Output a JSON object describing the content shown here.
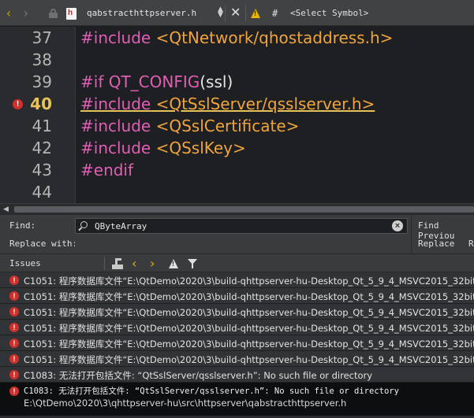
{
  "tabbar": {
    "back_glyph": "‹",
    "forward_glyph": "›",
    "filename": "qabstracthttpserver.h",
    "file_icon_letter": "h",
    "close_glyph": "✕",
    "hash": "#",
    "symbol_selector": "<Select Symbol>"
  },
  "editor": {
    "lines": [
      {
        "number": "37",
        "code": "#include <QtNetwork/qhostaddress.h>"
      },
      {
        "number": "38",
        "code": ""
      },
      {
        "number": "39",
        "code": "#if QT_CONFIG(ssl)"
      },
      {
        "number": "40",
        "code": "#include <QtSslServer/qsslserver.h>"
      },
      {
        "number": "41",
        "code": "#include <QSslCertificate>"
      },
      {
        "number": "42",
        "code": "#include <QSslKey>"
      },
      {
        "number": "43",
        "code": "#endif"
      },
      {
        "number": "44",
        "code": ""
      }
    ],
    "tokens": {
      "l37_kw": "#include",
      "l37_str": " <QtNetwork/qhostaddress.h>",
      "l39_kw": "#if",
      "l39_macro": " QT_CONFIG",
      "l39_rest": "(ssl)",
      "l40_kw": "#include",
      "l40_str": "<QtSslServer/qsslserver.h>",
      "l41_kw": "#include",
      "l41_str": " <QSslCertificate>",
      "l42_kw": "#include",
      "l42_str": " <QSslKey>",
      "l43_kw": "#endif"
    }
  },
  "findbar": {
    "find_label": "Find:",
    "find_value": "QByteArray",
    "replace_label": "Replace with:",
    "find_previous": "Find Previou",
    "replace_button": "Replace",
    "replace_trunc": "R"
  },
  "issues": {
    "title": "Issues",
    "prev_glyph": "‹",
    "next_glyph": "›",
    "items": [
      {
        "text": "C1051: 程序数据库文件“E:\\QtDemo\\2020\\3\\build-qhttpserver-hu-Desktop_Qt_5_9_4_MSVC2015_32bit"
      },
      {
        "text": "C1051: 程序数据库文件“E:\\QtDemo\\2020\\3\\build-qhttpserver-hu-Desktop_Qt_5_9_4_MSVC2015_32bit"
      },
      {
        "text": "C1051: 程序数据库文件“E:\\QtDemo\\2020\\3\\build-qhttpserver-hu-Desktop_Qt_5_9_4_MSVC2015_32bit"
      },
      {
        "text": "C1051: 程序数据库文件“E:\\QtDemo\\2020\\3\\build-qhttpserver-hu-Desktop_Qt_5_9_4_MSVC2015_32bit"
      },
      {
        "text": "C1051: 程序数据库文件“E:\\QtDemo\\2020\\3\\build-qhttpserver-hu-Desktop_Qt_5_9_4_MSVC2015_32bit"
      },
      {
        "text": "C1051: 程序数据库文件“E:\\QtDemo\\2020\\3\\build-qhttpserver-hu-Desktop_Qt_5_9_4_MSVC2015_32bit"
      },
      {
        "text": "C1083: 无法打开包括文件: “QtSslServer/qsslserver.h”: No such file or directory"
      }
    ],
    "selected": {
      "text": "C1083: 无法打开包括文件: “QtSslServer/qsslserver.h”: No such file or directory",
      "path": "E:\\QtDemo\\2020\\3\\qhttpserver-hu\\src\\httpserver\\qabstracthttpserver.h"
    }
  },
  "colors": {
    "keyword": "#e05fb5",
    "string": "#f0a53c",
    "error": "#d0302b",
    "accent": "#e8b500"
  }
}
